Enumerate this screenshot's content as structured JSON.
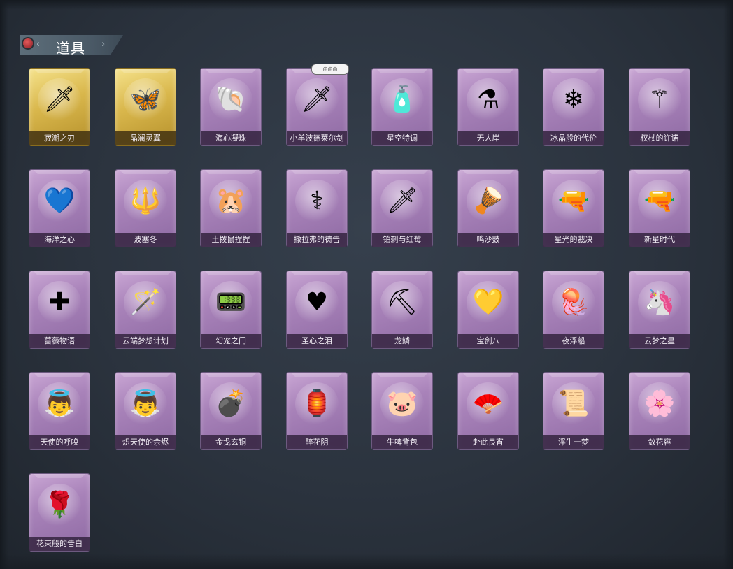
{
  "section": {
    "title": "道具",
    "left_icon": "chevron-left-icon",
    "right_icon": "chevron-right-icon"
  },
  "items": [
    {
      "name": "寂潮之刃",
      "icon": "sword-icon",
      "glyph": "🗡",
      "rarity": "gold"
    },
    {
      "name": "晶澜灵翼",
      "icon": "butterfly-wings-icon",
      "glyph": "🦋",
      "rarity": "gold"
    },
    {
      "name": "海心凝珠",
      "icon": "shell-pearl-icon",
      "glyph": "🐚",
      "rarity": "purple"
    },
    {
      "name": "小羊波德莱尔剑",
      "icon": "sword-icon",
      "glyph": "🗡",
      "rarity": "purple"
    },
    {
      "name": "星空特调",
      "icon": "bottle-icon",
      "glyph": "🧴",
      "rarity": "purple"
    },
    {
      "name": "无人岸",
      "icon": "potion-icon",
      "glyph": "⚗",
      "rarity": "purple"
    },
    {
      "name": "冰晶般的代价",
      "icon": "ice-flower-icon",
      "glyph": "❄",
      "rarity": "purple"
    },
    {
      "name": "权杖的许诺",
      "icon": "scepter-icon",
      "glyph": "⚚",
      "rarity": "purple"
    },
    {
      "name": "海洋之心",
      "icon": "heart-necklace-icon",
      "glyph": "💙",
      "rarity": "purple"
    },
    {
      "name": "波塞冬",
      "icon": "trident-icon",
      "glyph": "🔱",
      "rarity": "purple"
    },
    {
      "name": "土拨鼠捏捏",
      "icon": "hamster-icon",
      "glyph": "🐹",
      "rarity": "purple"
    },
    {
      "name": "撒拉弗的祷告",
      "icon": "staff-icon",
      "glyph": "⚕",
      "rarity": "purple"
    },
    {
      "name": "铂刺与红莓",
      "icon": "blade-icon",
      "glyph": "🗡",
      "rarity": "purple"
    },
    {
      "name": "鸣沙鼓",
      "icon": "drum-icon",
      "glyph": "🪘",
      "rarity": "purple"
    },
    {
      "name": "星光的裁决",
      "icon": "shotgun-icon",
      "glyph": "🔫",
      "rarity": "purple"
    },
    {
      "name": "新星时代",
      "icon": "revolver-icon",
      "glyph": "🔫",
      "rarity": "purple"
    },
    {
      "name": "蔷薇物语",
      "icon": "first-aid-box-icon",
      "glyph": "✚",
      "rarity": "purple"
    },
    {
      "name": "云端梦想计划",
      "icon": "magic-wand-icon",
      "glyph": "🪄",
      "rarity": "purple"
    },
    {
      "name": "幻宠之门",
      "icon": "tablet-device-icon",
      "glyph": "📟",
      "rarity": "purple"
    },
    {
      "name": "圣心之泪",
      "icon": "heart-wand-icon",
      "glyph": "♥",
      "rarity": "purple"
    },
    {
      "name": "龙鳞",
      "icon": "golden-shovel-icon",
      "glyph": "⛏",
      "rarity": "purple"
    },
    {
      "name": "宝剑八",
      "icon": "heart-locket-icon",
      "glyph": "💛",
      "rarity": "purple"
    },
    {
      "name": "夜浮船",
      "icon": "jellyfish-icon",
      "glyph": "🪼",
      "rarity": "purple"
    },
    {
      "name": "云梦之星",
      "icon": "unicorn-cloud-icon",
      "glyph": "🦄",
      "rarity": "purple"
    },
    {
      "name": "天使的呼唤",
      "icon": "angel-doll-icon",
      "glyph": "👼",
      "rarity": "purple"
    },
    {
      "name": "炽天使的余烬",
      "icon": "angel-doll-icon",
      "glyph": "👼",
      "rarity": "purple"
    },
    {
      "name": "金戈玄铜",
      "icon": "grenade-icon",
      "glyph": "💣",
      "rarity": "purple"
    },
    {
      "name": "醉花阴",
      "icon": "flower-lantern-icon",
      "glyph": "🏮",
      "rarity": "purple"
    },
    {
      "name": "牛啤背包",
      "icon": "pig-backpack-icon",
      "glyph": "🐷",
      "rarity": "purple"
    },
    {
      "name": "赴此良宵",
      "icon": "fan-icon",
      "glyph": "🪭",
      "rarity": "purple"
    },
    {
      "name": "浮生一梦",
      "icon": "scroll-icon",
      "glyph": "📜",
      "rarity": "purple"
    },
    {
      "name": "敛花容",
      "icon": "floral-headband-icon",
      "glyph": "🌸",
      "rarity": "purple"
    },
    {
      "name": "花束般的告白",
      "icon": "rose-icon",
      "glyph": "🌹",
      "rarity": "purple"
    }
  ]
}
